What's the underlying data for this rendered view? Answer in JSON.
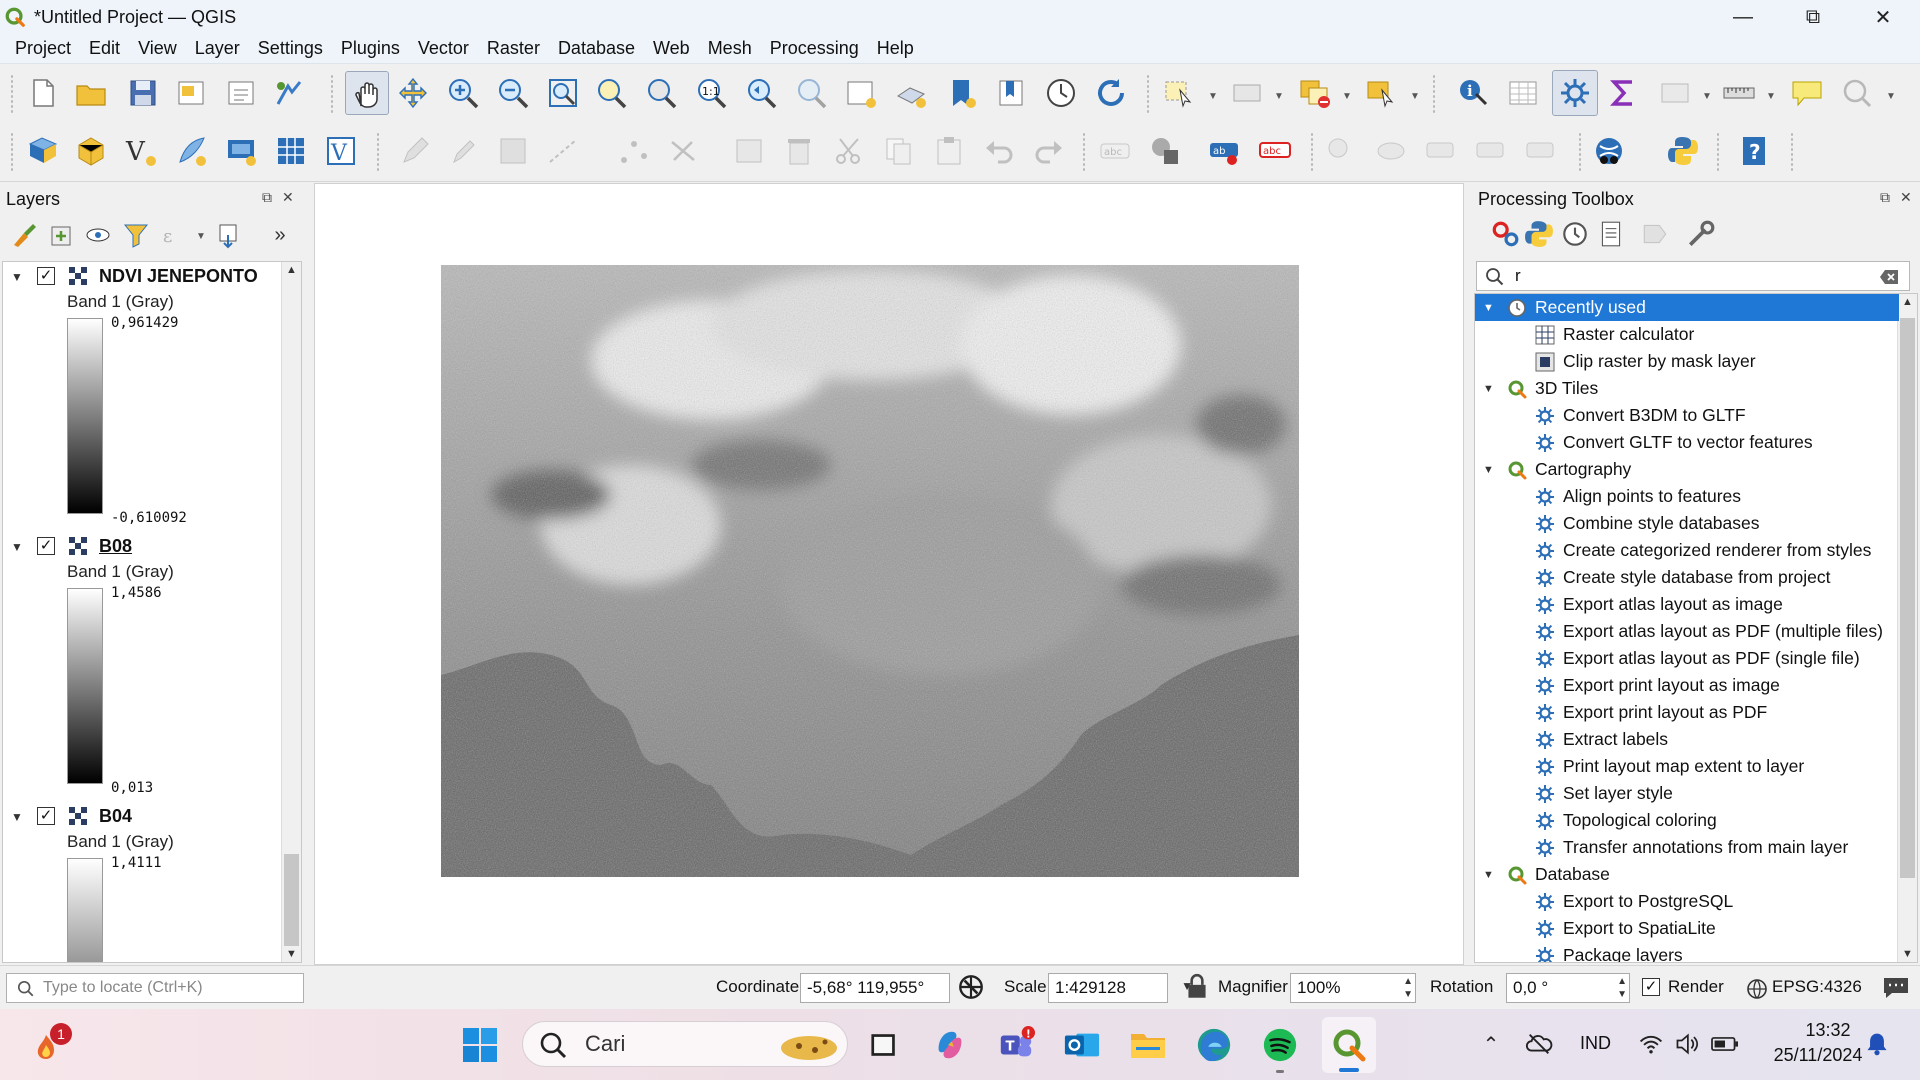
{
  "window": {
    "title": "*Untitled Project — QGIS"
  },
  "menu": [
    "Project",
    "Edit",
    "View",
    "Layer",
    "Settings",
    "Plugins",
    "Vector",
    "Raster",
    "Database",
    "Web",
    "Mesh",
    "Processing",
    "Help"
  ],
  "layers_panel": {
    "title": "Layers",
    "layers": [
      {
        "name": "NDVI JENEPONTO",
        "band": "Band 1 (Gray)",
        "max": "0,961429",
        "min": "-0,610092",
        "checked": true
      },
      {
        "name": "B08",
        "band": "Band 1 (Gray)",
        "max": "1,4586",
        "min": "0,013",
        "checked": true
      },
      {
        "name": "B04",
        "band": "Band 1 (Gray)",
        "max": "1,4111",
        "checked": true
      }
    ]
  },
  "toolbox": {
    "title": "Processing Toolbox",
    "search_value": "r",
    "groups": [
      {
        "label": "Recently used",
        "selected": true,
        "icon": "clock-icon",
        "items": [
          "Raster calculator",
          "Clip raster by mask layer"
        ]
      },
      {
        "label": "3D Tiles",
        "icon": "qgis-icon",
        "items": [
          "Convert B3DM to GLTF",
          "Convert GLTF to vector features"
        ]
      },
      {
        "label": "Cartography",
        "icon": "qgis-icon",
        "items": [
          "Align points to features",
          "Combine style databases",
          "Create categorized renderer from styles",
          "Create style database from project",
          "Export atlas layout as image",
          "Export atlas layout as PDF (multiple files)",
          "Export atlas layout as PDF (single file)",
          "Export print layout as image",
          "Export print layout as PDF",
          "Extract labels",
          "Print layout map extent to layer",
          "Set layer style",
          "Topological coloring",
          "Transfer annotations from main layer"
        ]
      },
      {
        "label": "Database",
        "icon": "qgis-icon",
        "items": [
          "Export to PostgreSQL",
          "Export to SpatiaLite",
          "Package layers"
        ]
      }
    ]
  },
  "statusbar": {
    "locator_placeholder": "Type to locate (Ctrl+K)",
    "coordinate_label": "Coordinate",
    "coordinate_value": "-5,68° 119,955°",
    "scale_label": "Scale",
    "scale_value": "1:429128",
    "magnifier_label": "Magnifier",
    "magnifier_value": "100%",
    "rotation_label": "Rotation",
    "rotation_value": "0,0 °",
    "render_label": "Render",
    "crs": "EPSG:4326"
  },
  "taskbar": {
    "search_text": "Cari",
    "notification_count": "1",
    "language": "IND",
    "time": "13:32",
    "date": "25/11/2024"
  },
  "colors": {
    "selection": "#1f78d6",
    "qgis_green": "#589632",
    "qgis_yellow": "#ee7913"
  }
}
